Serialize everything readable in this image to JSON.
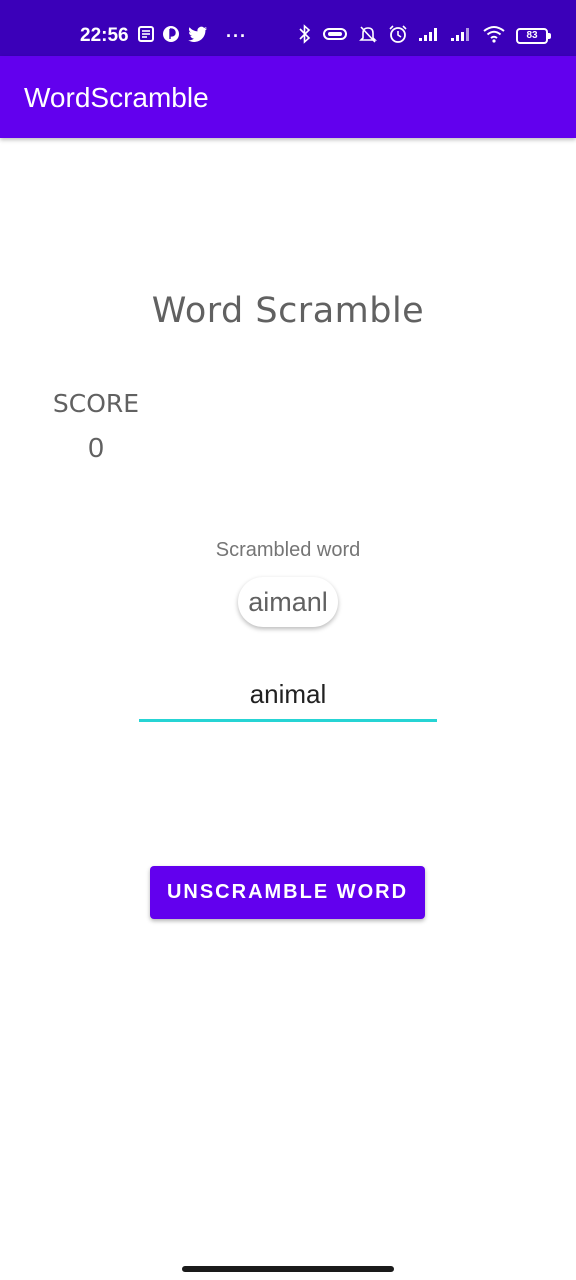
{
  "status_bar": {
    "time": "22:56",
    "more_indicator": "···",
    "battery_level": "83",
    "left_icons": [
      "notes-icon",
      "circle-p-icon",
      "twitter-icon"
    ],
    "right_icons": [
      "bluetooth-icon",
      "vibrate-icon",
      "mute-bell-icon",
      "alarm-icon",
      "signal-1-icon",
      "signal-2-icon",
      "wifi-icon",
      "battery-icon"
    ]
  },
  "app_bar": {
    "title": "WordScramble"
  },
  "game": {
    "title": "Word Scramble",
    "score_label": "SCORE",
    "score_value": "0",
    "scrambled_label": "Scrambled word",
    "scrambled_word": "aimanl",
    "answer_value": "animal",
    "unscramble_button": "UNSCRAMBLE WORD"
  },
  "colors": {
    "status_bar": "#3b00b9",
    "app_bar": "#6200ee",
    "accent": "#26d4d4",
    "button": "#6200ee"
  }
}
